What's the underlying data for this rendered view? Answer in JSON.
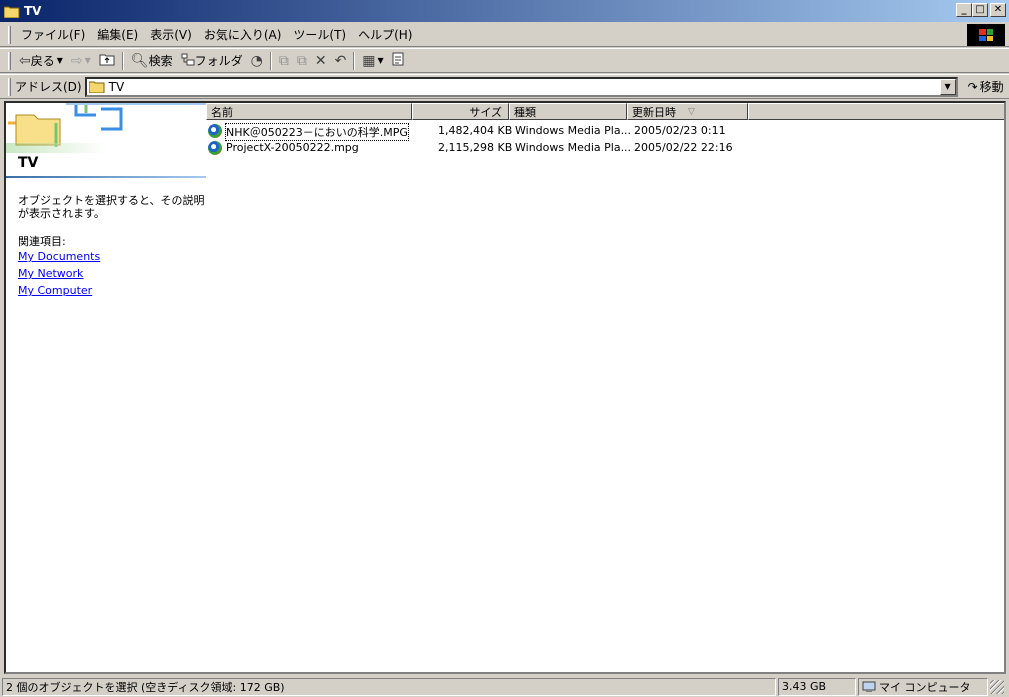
{
  "window": {
    "title": "TV"
  },
  "menu": [
    "ファイル(F)",
    "編集(E)",
    "表示(V)",
    "お気に入り(A)",
    "ツール(T)",
    "ヘルプ(H)"
  ],
  "toolbar": {
    "back_label": "戻る",
    "search_label": "検索",
    "folders_label": "フォルダ"
  },
  "address": {
    "label": "アドレス(D)",
    "value": "TV",
    "go_label": "移動"
  },
  "left_pane": {
    "folder_title": "TV",
    "description": "オブジェクトを選択すると、その説明が表示されます。",
    "related_label": "関連項目:",
    "links": [
      "My Documents",
      "My Network",
      "My Computer"
    ]
  },
  "list": {
    "columns": [
      "名前",
      "サイズ",
      "種類",
      "更新日時"
    ],
    "sort_indicator": "▽",
    "files": [
      {
        "name": "NHK＠050223－においの科学.MPG",
        "size": "1,482,404 KB",
        "type": "Windows Media Pla...",
        "modified": "2005/02/23 0:11"
      },
      {
        "name": "ProjectX-20050222.mpg",
        "size": "2,115,298 KB",
        "type": "Windows Media Pla...",
        "modified": "2005/02/22 22:16"
      }
    ]
  },
  "status": {
    "selection": "2 個のオブジェクトを選択 (空きディスク領域: 172 GB)",
    "size": "3.43 GB",
    "location": "マイ コンピュータ"
  },
  "colors": {
    "titlebar_start": "#0a246a",
    "titlebar_end": "#a6caf0",
    "link": "#0000ff",
    "chrome": "#d4d0c8"
  }
}
